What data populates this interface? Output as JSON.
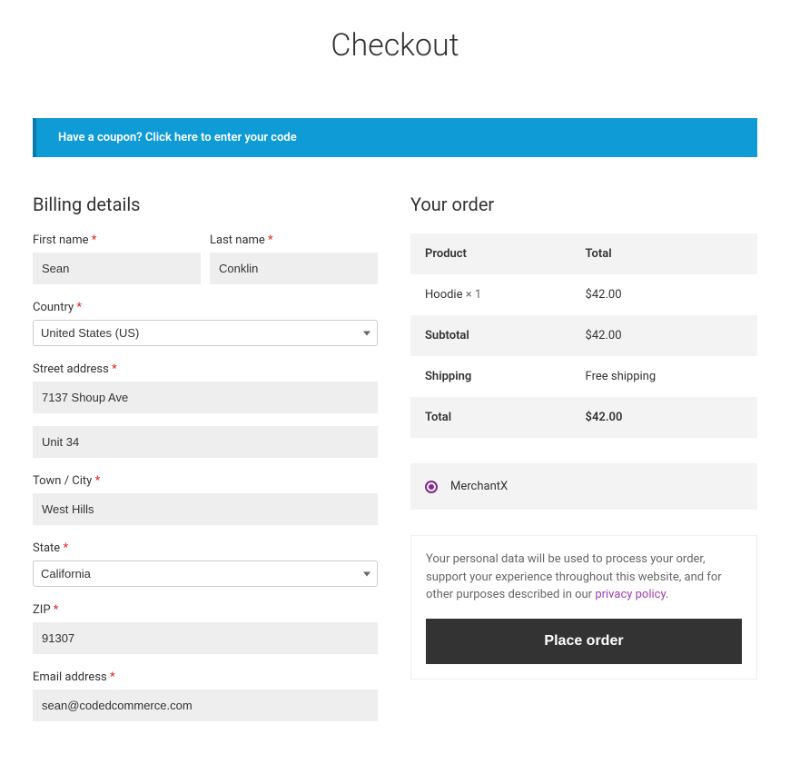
{
  "page": {
    "title": "Checkout"
  },
  "coupon": {
    "prompt": "Have a coupon? ",
    "link": "Click here to enter your code"
  },
  "billing": {
    "heading": "Billing details",
    "first_name": {
      "label": "First name",
      "value": "Sean"
    },
    "last_name": {
      "label": "Last name",
      "value": "Conklin"
    },
    "country": {
      "label": "Country",
      "value": "United States (US)"
    },
    "street": {
      "label": "Street address",
      "value1": "7137 Shoup Ave",
      "value2": "Unit 34"
    },
    "city": {
      "label": "Town / City",
      "value": "West Hills"
    },
    "state": {
      "label": "State",
      "value": "California"
    },
    "zip": {
      "label": "ZIP",
      "value": "91307"
    },
    "email": {
      "label": "Email address",
      "value": "sean@codedcommerce.com"
    }
  },
  "order": {
    "heading": "Your order",
    "columns": {
      "product": "Product",
      "total": "Total"
    },
    "items": [
      {
        "name": "Hoodie ",
        "qty": "× 1",
        "total": "$42.00"
      }
    ],
    "subtotal": {
      "label": "Subtotal",
      "value": "$42.00"
    },
    "shipping": {
      "label": "Shipping",
      "value": "Free shipping"
    },
    "total": {
      "label": "Total",
      "value": "$42.00"
    }
  },
  "payment": {
    "methods": [
      {
        "name": "MerchantX",
        "selected": true
      }
    ]
  },
  "privacy": {
    "text_before": "Your personal data will be used to process your order, support your experience throughout this website, and for other purposes described in our ",
    "link": "privacy policy",
    "text_after": "."
  },
  "actions": {
    "place_order": "Place order"
  },
  "required_mark": "*"
}
